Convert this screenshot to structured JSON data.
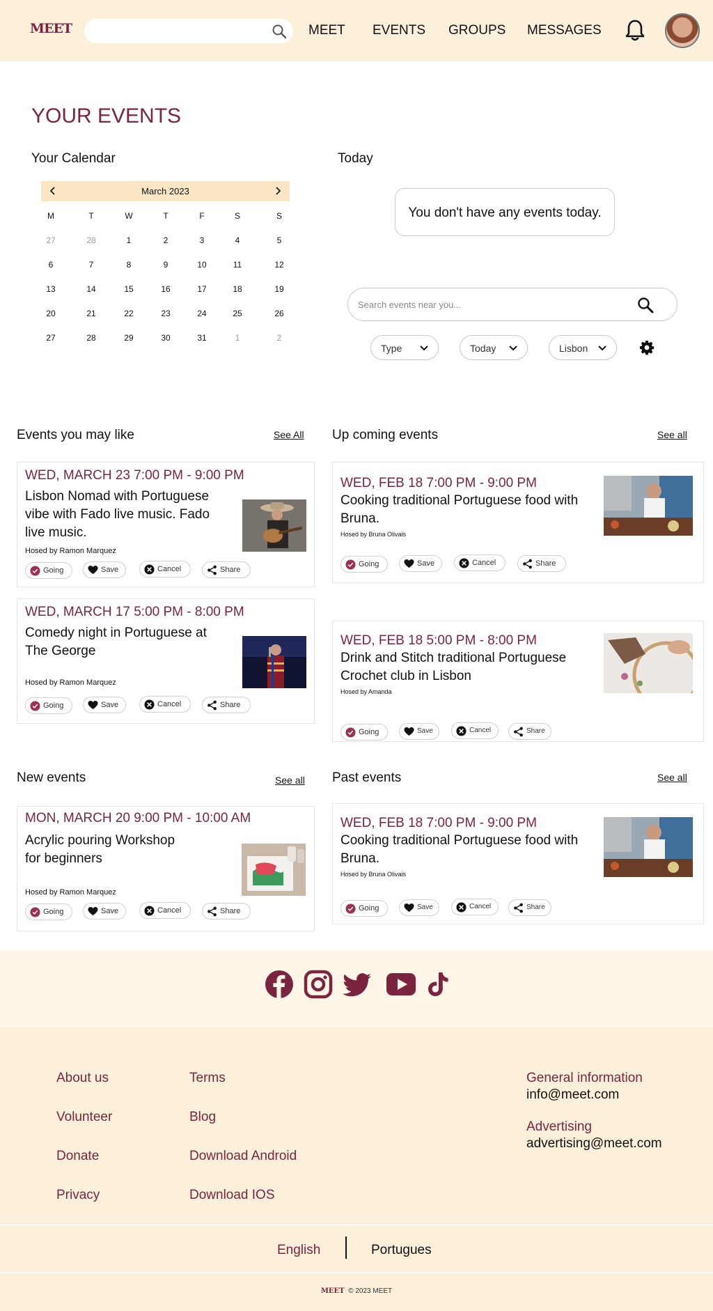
{
  "header": {
    "logo": "MEET",
    "nav": [
      "MEET",
      "EVENTS",
      "GROUPS",
      "MESSAGES"
    ]
  },
  "page": {
    "title": "YOUR EVENTS",
    "calendar_title": "Your Calendar",
    "today_title": "Today",
    "today_message": "You don't have any events today."
  },
  "calendar": {
    "month": "March 2023",
    "weekdays": [
      "M",
      "T",
      "W",
      "T",
      "F",
      "S",
      "S"
    ],
    "weeks": [
      [
        "27",
        "28",
        "1",
        "2",
        "3",
        "4",
        "5"
      ],
      [
        "6",
        "7",
        "8",
        "9",
        "10",
        "11",
        "12"
      ],
      [
        "13",
        "14",
        "15",
        "16",
        "17",
        "18",
        "19"
      ],
      [
        "20",
        "21",
        "22",
        "23",
        "24",
        "25",
        "26"
      ],
      [
        "27",
        "28",
        "29",
        "30",
        "31",
        "1",
        "2"
      ]
    ]
  },
  "search": {
    "placeholder": "Search events near you...",
    "filters": [
      "Type",
      "Today",
      "Lisbon"
    ]
  },
  "sections": {
    "may_like": {
      "title": "Events you may like",
      "see_all": "See All"
    },
    "upcoming": {
      "title": "Up coming events",
      "see_all": "See all"
    },
    "new": {
      "title": "New events",
      "see_all": "See all"
    },
    "past": {
      "title": "Past events",
      "see_all": "See all"
    }
  },
  "actions": {
    "going": "Going",
    "save": "Save",
    "cancel": "Cancel",
    "share": "Share"
  },
  "events": {
    "like1": {
      "date": "WED, MARCH 23  7:00 PM - 9:00 PM",
      "title": "Lisbon Nomad with Portuguese vibe with Fado live music. Fado live music.",
      "host": "Hosed by Ramon Marquez"
    },
    "like2": {
      "date": "WED, MARCH 17  5:00 PM - 8:00 PM",
      "title": "Comedy night in Portuguese at The George",
      "host": "Hosed by Ramon Marquez"
    },
    "up1": {
      "date": "WED, FEB 18  7:00 PM - 9:00 PM",
      "title": "Cooking traditional Portuguese food with Bruna.",
      "host": "Hosed by Bruna Olivais"
    },
    "up2": {
      "date": "WED, FEB 18  5:00 PM - 8:00 PM",
      "title": "Drink and Stitch traditional Portuguese Crochet club in Lisbon",
      "host": "Hosed by Amanda"
    },
    "new1": {
      "date": "MON,  MARCH 20  9:00 PM - 10:00 AM",
      "title": "Acrylic pouring Workshop for beginners",
      "host": "Hosed by Ramon Marquez"
    },
    "past1": {
      "date": "WED, FEB 18  7:00 PM - 9:00 PM",
      "title": "Cooking traditional Portuguese food with Bruna.",
      "host": "Hosed by Bruna Olivais"
    }
  },
  "footer": {
    "col1": [
      "About us",
      "Volunteer",
      "Donate",
      "Privacy"
    ],
    "col2": [
      "Terms",
      "Blog",
      "Download Android",
      "Download IOS"
    ],
    "general_label": "General information",
    "general_email": "info@meet.com",
    "advertising_label": "Advertising",
    "advertising_email": "advertising@meet.com",
    "languages": [
      "English",
      "Portugues"
    ],
    "copyright": "© 2023 MEET",
    "mini_logo": "MEET"
  },
  "colors": {
    "accent": "#7a2440",
    "header_bg": "#fdf0da",
    "calendar_head_bg": "#fbe6c6"
  }
}
